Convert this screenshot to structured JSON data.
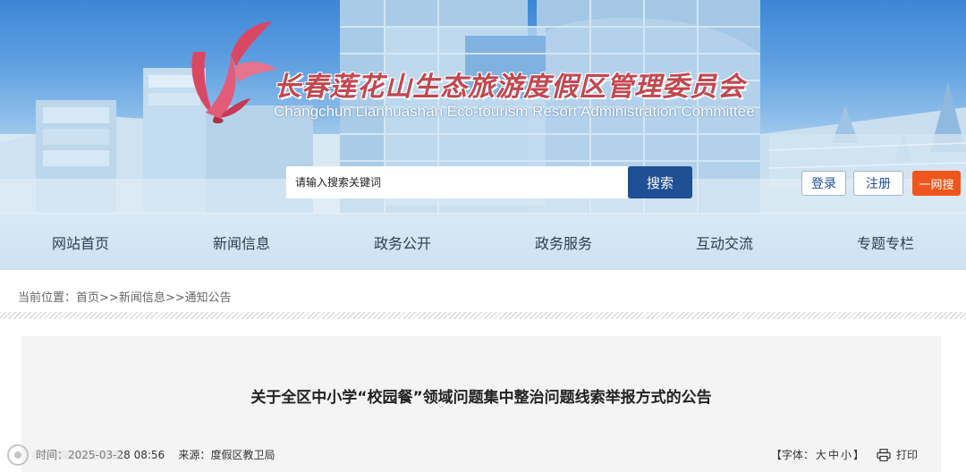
{
  "header": {
    "title_cn": "长春莲花山生态旅游度假区管理委员会",
    "title_en": "Changchun Lianhuashan Eco-tourism Resort  Administration Committee"
  },
  "search": {
    "placeholder": "请输入搜索关键词",
    "button_label": "搜索"
  },
  "account": {
    "login_label": "登录",
    "register_label": "注册",
    "net_search_label": "一网搜"
  },
  "nav": {
    "items": [
      {
        "label": "网站首页"
      },
      {
        "label": "新闻信息"
      },
      {
        "label": "政务公开"
      },
      {
        "label": "政务服务"
      },
      {
        "label": "互动交流"
      },
      {
        "label": "专题专栏"
      }
    ]
  },
  "breadcrumb": {
    "prefix": "当前位置：",
    "home": "首页",
    "sep1": ">>",
    "news": "新闻信息",
    "sep2": ">>",
    "notice": "通知公告"
  },
  "article": {
    "title": "关于全区中小学“校园餐”领域问题集中整治问题线索举报方式的公告",
    "time_label": "时间：",
    "time_value": "2025-03-28 08:56",
    "source_label": "来源：",
    "source_value": "度假区教卫局",
    "font_label_open": "【字体：",
    "font_large": "大",
    "font_medium": "中",
    "font_small": "小",
    "font_label_close": "】",
    "print_label": "打印"
  },
  "colors": {
    "accent_blue": "#1f4f94",
    "net_search_orange": "#f0561b",
    "title_red": "#c2474f",
    "nav_bg": "#d8e8f5"
  }
}
